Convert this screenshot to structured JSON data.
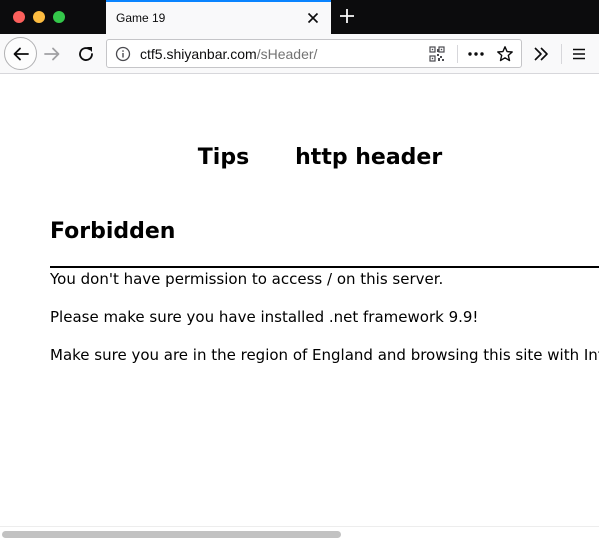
{
  "browser": {
    "tab_title": "Game 19",
    "url_host": "ctf5.shiyanbar.com",
    "url_path": "/sHeader/",
    "icons": {
      "back": "arrow-left-icon",
      "forward": "arrow-right-icon",
      "reload": "reload-icon",
      "site_info": "info-icon",
      "qr": "qr-code-icon",
      "page_actions": "more-horizontal-icon",
      "bookmark": "star-icon",
      "overflow": "double-chevron-right-icon",
      "menu": "hamburger-icon",
      "new_tab": "plus-icon",
      "tab_close": "close-icon"
    },
    "colors": {
      "tab_accent": "#0a84ff",
      "titlebar": "#0c0c0d",
      "traffic_close": "#fc605c",
      "traffic_min": "#fdbc40",
      "traffic_max": "#34c84a"
    }
  },
  "page": {
    "tips_heading": "Tips      http header",
    "forbidden_title": "Forbidden",
    "line1": "You don't have permission to access / on this server.",
    "line2": "Please make sure you have installed .net framework 9.9!",
    "line3": "Make sure you are in the region of England and browsing this site with Interr"
  }
}
